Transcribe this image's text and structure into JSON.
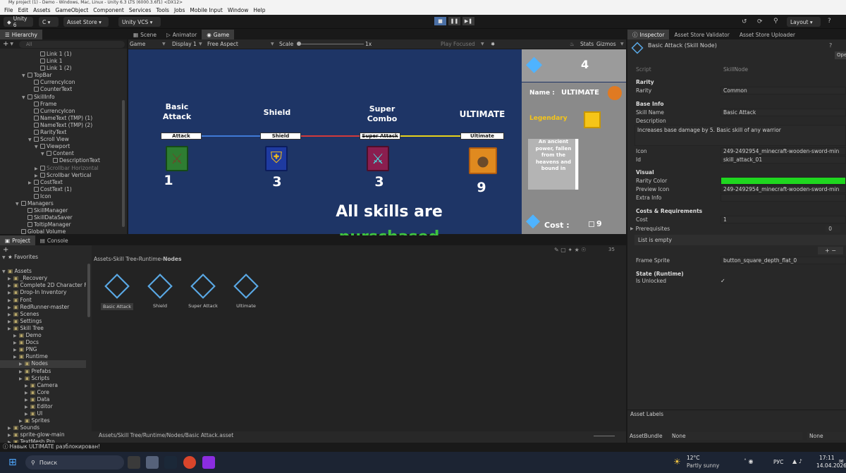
{
  "window_title": "My project (1) - Demo - Windows, Mac, Linux - Unity 6.3 LTS (6000.3.6f1) <DX12>",
  "menu": [
    "File",
    "Edit",
    "Assets",
    "GameObject",
    "Component",
    "Services",
    "Tools",
    "Jobs",
    "Mobile Input",
    "Window",
    "Help"
  ],
  "toolbar": {
    "account": "Unity 6",
    "cloud": "C ▾",
    "asset_store": "Asset Store ▾",
    "vcs": "Unity VCS ▾",
    "layout": "Layout ▾"
  },
  "hierarchy": {
    "tab": "Hierarchy",
    "search_placeholder": "All",
    "items": [
      {
        "label": "Link 1 (1)",
        "indent": 5,
        "arrow": "",
        "icon": true
      },
      {
        "label": "Link 1",
        "indent": 5,
        "arrow": "",
        "icon": true
      },
      {
        "label": "Link 1 (2)",
        "indent": 5,
        "arrow": "",
        "icon": true
      },
      {
        "label": "TopBar",
        "indent": 3,
        "arrow": "▼",
        "icon": true
      },
      {
        "label": "CurrencyIcon",
        "indent": 4,
        "arrow": "",
        "icon": true
      },
      {
        "label": "CounterText",
        "indent": 4,
        "arrow": "",
        "icon": true
      },
      {
        "label": "SkillInfo",
        "indent": 3,
        "arrow": "▼",
        "icon": true
      },
      {
        "label": "Frame",
        "indent": 4,
        "arrow": "",
        "icon": true
      },
      {
        "label": "CurrencyIcon",
        "indent": 4,
        "arrow": "",
        "icon": true
      },
      {
        "label": "NameText (TMP) (1)",
        "indent": 4,
        "arrow": "",
        "icon": true
      },
      {
        "label": "NameText (TMP) (2)",
        "indent": 4,
        "arrow": "",
        "icon": true
      },
      {
        "label": "RarityText",
        "indent": 4,
        "arrow": "",
        "icon": true
      },
      {
        "label": "Scroll View",
        "indent": 4,
        "arrow": "▼",
        "icon": true
      },
      {
        "label": "Viewport",
        "indent": 5,
        "arrow": "▼",
        "icon": true
      },
      {
        "label": "Content",
        "indent": 6,
        "arrow": "▼",
        "icon": true
      },
      {
        "label": "DescriptionText",
        "indent": 7,
        "arrow": "",
        "icon": true
      },
      {
        "label": "Scrollbar Horizontal",
        "indent": 5,
        "arrow": "▶",
        "icon": true,
        "dim": true
      },
      {
        "label": "Scrollbar Vertical",
        "indent": 5,
        "arrow": "▶",
        "icon": true
      },
      {
        "label": "CostText",
        "indent": 4,
        "arrow": "▶",
        "icon": true
      },
      {
        "label": "CostText (1)",
        "indent": 4,
        "arrow": "",
        "icon": true
      },
      {
        "label": "Icon",
        "indent": 4,
        "arrow": "",
        "icon": true
      },
      {
        "label": "Managers",
        "indent": 2,
        "arrow": "▼",
        "icon": true
      },
      {
        "label": "SkillManager",
        "indent": 3,
        "arrow": "",
        "icon": true
      },
      {
        "label": "SkillDataSaver",
        "indent": 3,
        "arrow": "",
        "icon": true
      },
      {
        "label": "ToltipManager",
        "indent": 3,
        "arrow": "",
        "icon": true
      },
      {
        "label": "Global Volume",
        "indent": 2,
        "arrow": "",
        "icon": true
      }
    ]
  },
  "center_tabs": [
    "Scene",
    "Animator",
    "Game"
  ],
  "game_toolbar": {
    "display_mode": "Game",
    "display": "Display 1",
    "aspect": "Free Aspect",
    "scale_label": "Scale",
    "scale_value": "1x",
    "play_focused": "Play Focused",
    "stats": "Stats",
    "gizmos": "Gizmos"
  },
  "game": {
    "skills": [
      {
        "title": "Basic\nAttack",
        "pill": "Attack",
        "count": "1",
        "color": "#2e7d32"
      },
      {
        "title": "Shield",
        "pill": "Shield",
        "count": "3",
        "color": "#1e3aa0"
      },
      {
        "title": "Super\nCombo",
        "pill": "Super Attack",
        "count": "3",
        "color": "#8a1e4f"
      },
      {
        "title": "ULTIMATE",
        "pill": "Ultimate",
        "count": "9",
        "color": "#e08a1f"
      }
    ],
    "message_line1": "All skills are",
    "message_line2": "purschased",
    "currency_count": "4",
    "info_name_label": "Name :",
    "info_name_value": "ULTIMATE",
    "info_rarity": "Legendary",
    "info_description": "An ancient power, fallen from the heavens and bound in",
    "cost_label": "Cost :",
    "cost_value": "9"
  },
  "project": {
    "tabs": [
      "Project",
      "Console"
    ],
    "favorites": "Favorites",
    "assets_label": "Assets",
    "tree": [
      {
        "label": "_Recovery",
        "indent": 1
      },
      {
        "label": "Complete 2D Character F...",
        "indent": 1
      },
      {
        "label": "Drop-In Inventory",
        "indent": 1
      },
      {
        "label": "Font",
        "indent": 1
      },
      {
        "label": "RedRunner-master",
        "indent": 1
      },
      {
        "label": "Scenes",
        "indent": 1
      },
      {
        "label": "Settings",
        "indent": 1
      },
      {
        "label": "Skill Tree",
        "indent": 1
      },
      {
        "label": "Demo",
        "indent": 2
      },
      {
        "label": "Docs",
        "indent": 2
      },
      {
        "label": "PNG",
        "indent": 2
      },
      {
        "label": "Runtime",
        "indent": 2
      },
      {
        "label": "Nodes",
        "indent": 3,
        "selected": true
      },
      {
        "label": "Prefabs",
        "indent": 3
      },
      {
        "label": "Scripts",
        "indent": 3
      },
      {
        "label": "Camera",
        "indent": 4
      },
      {
        "label": "Core",
        "indent": 4
      },
      {
        "label": "Data",
        "indent": 4
      },
      {
        "label": "Editor",
        "indent": 4
      },
      {
        "label": "UI",
        "indent": 4
      },
      {
        "label": "Sprites",
        "indent": 3
      },
      {
        "label": "Sounds",
        "indent": 1
      },
      {
        "label": "sprite-glow-main",
        "indent": 1
      },
      {
        "label": "TextMesh Pro",
        "indent": 1
      }
    ],
    "breadcrumb": [
      "Assets",
      "Skill Tree",
      "Runtime",
      "Nodes"
    ],
    "hidden_count": "35",
    "assets": [
      "Basic Attack",
      "Shield",
      "Super Attack",
      "Ultimate"
    ],
    "path": "Assets/Skill Tree/Runtime/Nodes/Basic Attack.asset"
  },
  "inspector": {
    "tabs": [
      "Inspector",
      "Asset Store Validator",
      "Asset Store Uploader"
    ],
    "title": "Basic Attack (Skill Node)",
    "open_label": "Open",
    "script_label": "Script",
    "script_value": "SkillNode",
    "rarity_header": "Rarity",
    "rarity_label": "Rarity",
    "rarity_value": "Common",
    "baseinfo_header": "Base Info",
    "skillname_label": "Skill Name",
    "skillname_value": "Basic Attack",
    "description_label": "Description",
    "description_value": "Increases base damage by 5. Basic skill of any warrior",
    "icon_label": "Icon",
    "icon_value": "249-2492954_minecraft-wooden-sword-min",
    "id_label": "Id",
    "id_value": "skill_attack_01",
    "visual_header": "Visual",
    "raritycolor_label": "Rarity Color",
    "raritycolor": "#1fd71f",
    "previewicon_label": "Preview Icon",
    "previewicon_value": "249-2492954_minecraft-wooden-sword-min",
    "extrainfo_label": "Extra Info",
    "costreq_header": "Costs & Requirements",
    "cost_label": "Cost",
    "cost_value": "1",
    "prereq_label": "Prerequisites",
    "prereq_count": "0",
    "list_empty": "List is empty",
    "framesprite_label": "Frame Sprite",
    "framesprite_value": "button_square_depth_flat_0",
    "state_header": "State (Runtime)",
    "isunlocked_label": "Is Unlocked",
    "asset_labels": "Asset Labels",
    "assetbundle_label": "AssetBundle",
    "assetbundle_value": "None",
    "assetbundle_variant": "None"
  },
  "statusbar": "Навык ULTIMATE разблокирован!",
  "taskbar": {
    "search": "Поиск",
    "temp": "12°C",
    "weather": "Partly sunny",
    "lang": "РУС",
    "time": "17:11",
    "date": "14.04.2026"
  }
}
